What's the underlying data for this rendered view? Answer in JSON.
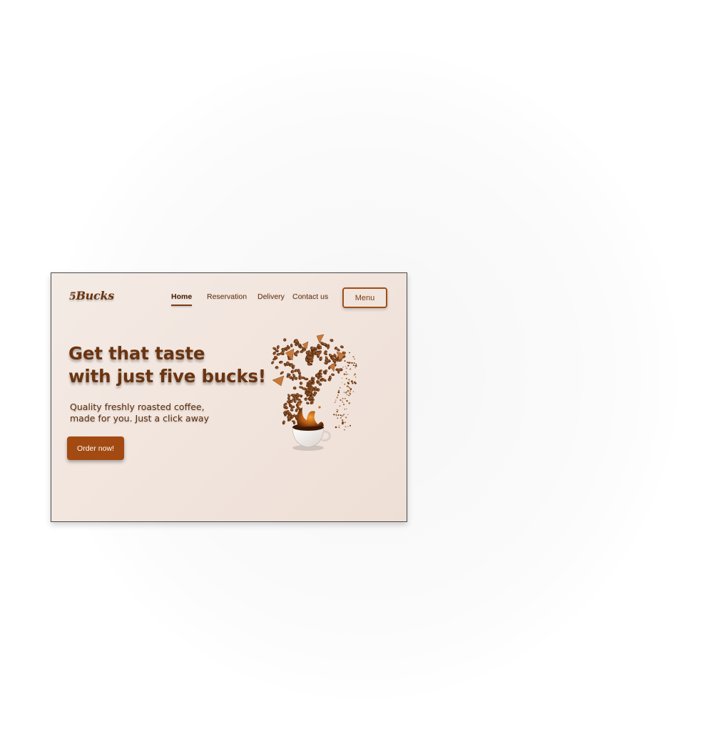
{
  "brand": {
    "logo_number": "5",
    "logo_name": "Bucks"
  },
  "nav": {
    "items": [
      {
        "label": "Home",
        "active": true
      },
      {
        "label": "Reservation",
        "active": false
      },
      {
        "label": "Delivery",
        "active": false
      },
      {
        "label": "Contact us",
        "active": false
      }
    ],
    "menu_button": "Menu"
  },
  "hero": {
    "title_line1": "Get that taste",
    "title_line2": "with just five bucks!",
    "subtitle_line1": "Quality freshly roasted coffee,",
    "subtitle_line2": "made for you. Just a click away",
    "cta_label": "Order now!",
    "illustration": "coffee-beans-heart-cup-illustration"
  },
  "colors": {
    "brand_brown": "#6b3410",
    "cta_background": "#a34a12",
    "page_background": "#f2e6de"
  }
}
